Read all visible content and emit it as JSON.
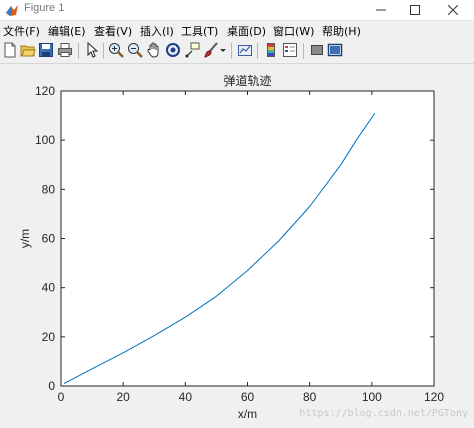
{
  "window": {
    "title": "Figure 1"
  },
  "menu": {
    "items": [
      {
        "label": "文件(F)"
      },
      {
        "label": "编辑(E)"
      },
      {
        "label": "查看(V)"
      },
      {
        "label": "插入(I)"
      },
      {
        "label": "工具(T)"
      },
      {
        "label": "桌面(D)"
      },
      {
        "label": "窗口(W)"
      },
      {
        "label": "帮助(H)"
      }
    ]
  },
  "toolbar": {
    "icons": [
      "new-figure-icon",
      "open-file-icon",
      "save-icon",
      "print-icon",
      "edit-plot-icon",
      "zoom-in-icon",
      "zoom-out-icon",
      "pan-icon",
      "rotate-3d-icon",
      "data-cursor-icon",
      "brush-icon",
      "brush-dropdown-icon",
      "link-plot-icon",
      "insert-colorbar-icon",
      "insert-legend-icon",
      "hide-plot-tools-icon",
      "show-plot-tools-icon"
    ]
  },
  "chart_data": {
    "type": "line",
    "title": "弹道轨迹",
    "xlabel": "x/m",
    "ylabel": "y/m",
    "xlim": [
      0,
      120
    ],
    "ylim": [
      0,
      120
    ],
    "xticks": [
      0,
      20,
      40,
      60,
      80,
      100,
      120
    ],
    "yticks": [
      0,
      20,
      40,
      60,
      80,
      100,
      120
    ],
    "grid": false,
    "series": [
      {
        "color": "#0072bd",
        "x": [
          1,
          10,
          20,
          30,
          40,
          50,
          60,
          70,
          80,
          90,
          95,
          101
        ],
        "y": [
          1,
          7,
          13.5,
          20.5,
          28,
          36.5,
          47,
          59,
          73,
          90,
          100,
          111
        ]
      }
    ]
  },
  "watermark": "https://blog.csdn.net/PGTony"
}
